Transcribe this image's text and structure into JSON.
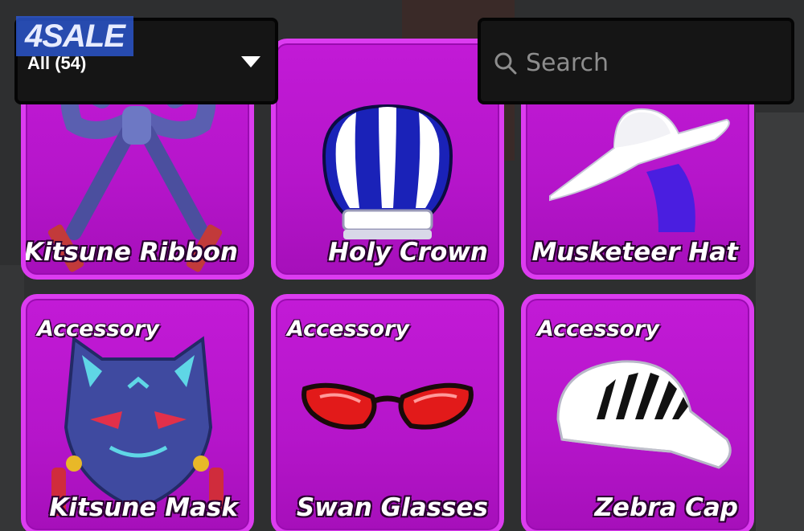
{
  "filter": {
    "selected": "All (54)"
  },
  "watermark": "4SALE",
  "search": {
    "placeholder": "Search",
    "value": ""
  },
  "items": [
    {
      "name": "Kitsune Ribbon",
      "category": ""
    },
    {
      "name": "Holy Crown",
      "category": ""
    },
    {
      "name": "Musketeer Hat",
      "category": ""
    },
    {
      "name": "Kitsune Mask",
      "category": "Accessory"
    },
    {
      "name": "Swan Glasses",
      "category": "Accessory"
    },
    {
      "name": "Zebra Cap",
      "category": "Accessory"
    }
  ],
  "colors": {
    "card": "#c21ad6",
    "card_border": "#dc3cf0",
    "panel": "#151515",
    "watermark": "#2c58d2"
  },
  "icons": [
    "search-icon",
    "chevron-down-icon"
  ]
}
